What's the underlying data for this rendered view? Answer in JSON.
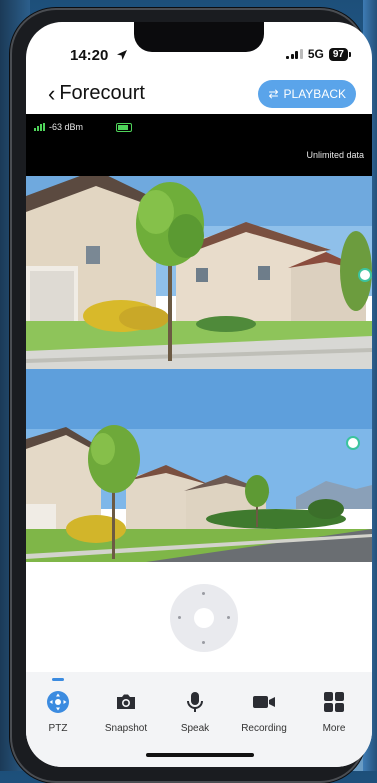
{
  "status_bar": {
    "time": "14:20",
    "network": "5G",
    "battery": "97"
  },
  "nav": {
    "back_label": "Forecourt",
    "playback_label": "PLAYBACK"
  },
  "live": {
    "signal": "-63 dBm",
    "data_plan": "Unlimited data"
  },
  "tabs": [
    {
      "label": "PTZ",
      "icon": "ptz-icon",
      "active": true
    },
    {
      "label": "Snapshot",
      "icon": "camera-icon",
      "active": false
    },
    {
      "label": "Speak",
      "icon": "microphone-icon",
      "active": false
    },
    {
      "label": "Recording",
      "icon": "video-camera-icon",
      "active": false
    },
    {
      "label": "More",
      "icon": "grid-icon",
      "active": false
    }
  ],
  "colors": {
    "accent": "#3b8be0",
    "playback": "#5aa4ea",
    "live_green": "#4fd35a",
    "ptz_marker": "#3cc39e"
  }
}
